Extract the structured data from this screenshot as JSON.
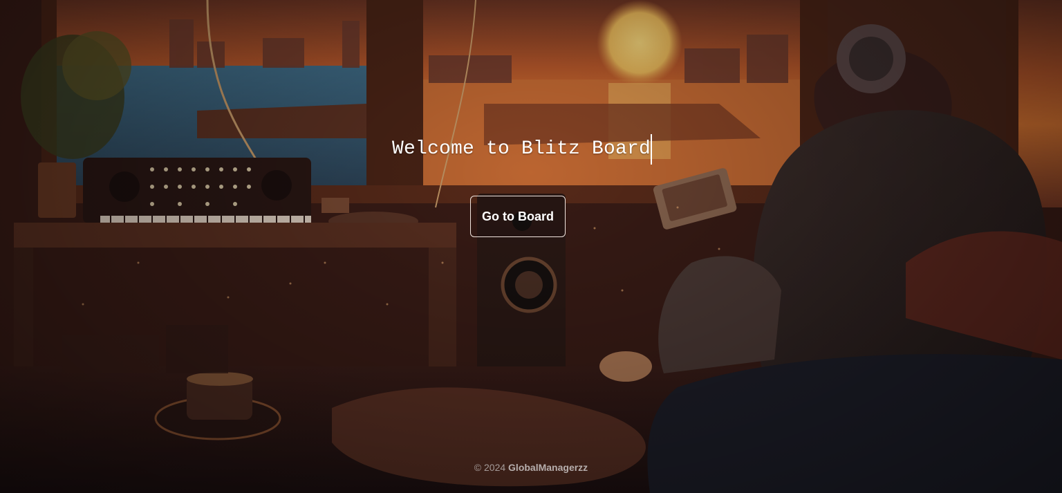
{
  "hero": {
    "welcome_text": "Welcome to Blitz Board",
    "cta_label": "Go to Board"
  },
  "footer": {
    "copyright": "© 2024",
    "brand": "GlobalManagerzz"
  },
  "colors": {
    "text": "#ffffff",
    "button_border": "#f2e6e0",
    "footer_text": "#a49a98",
    "sunset_orange": "#e07a2f",
    "room_brown": "#3a1a14"
  },
  "icons": {
    "background": "lofi-room-sunset-illustration"
  }
}
